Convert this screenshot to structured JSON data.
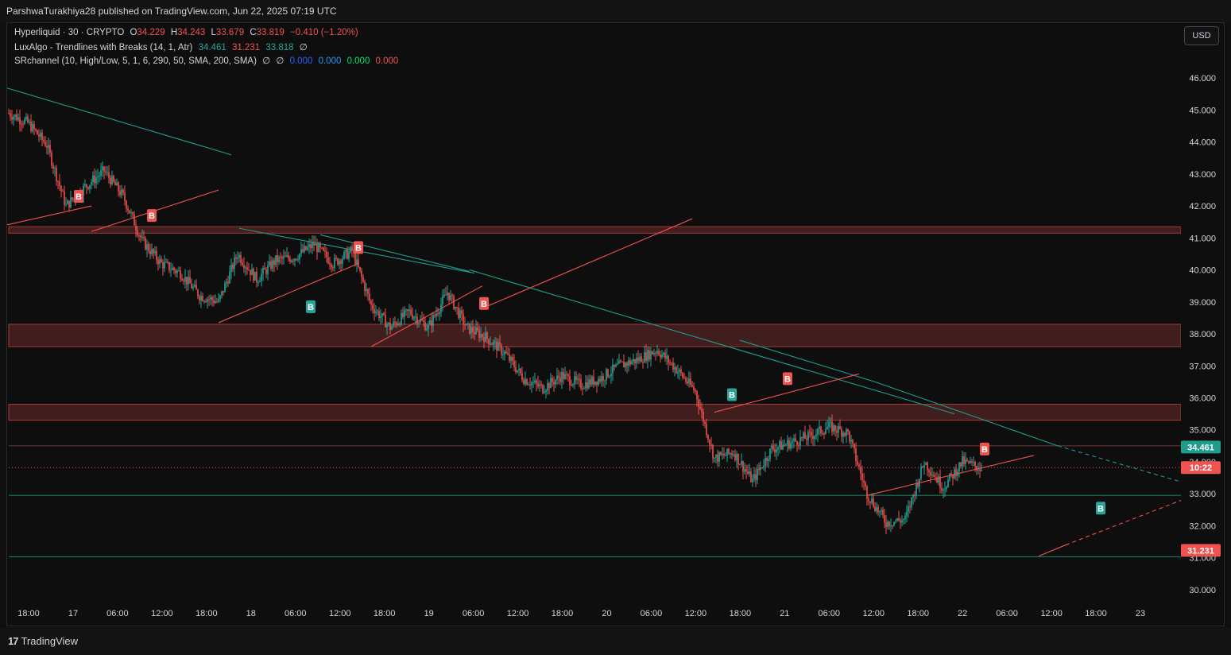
{
  "header": {
    "published": "ParshwaTurakhiya28 published on TradingView.com, Jun 22, 2025 07:19 UTC"
  },
  "legend": {
    "line1": {
      "symbol": "Hyperliquid · 30 · CRYPTO",
      "o_label": "O",
      "o": "34.229",
      "h_label": "H",
      "h": "34.243",
      "l_label": "L",
      "l": "33.679",
      "c_label": "C",
      "c": "33.819",
      "change": "−0.410 (−1.20%)"
    },
    "line2": {
      "name": "LuxAlgo - Trendlines with Breaks (14, 1, Atr)",
      "v1": "34.461",
      "v2": "31.231",
      "v3": "33.818",
      "v4": "∅"
    },
    "line3": {
      "name": "SRchannel (10, High/Low, 5, 1, 6, 290, 50, SMA, 200, SMA)",
      "v1": "∅",
      "v2": "∅",
      "v3": "0.000",
      "v4": "0.000",
      "v5": "0.000",
      "v6": "0.000"
    }
  },
  "currency_button": "USD",
  "footer": {
    "logo_text": "TradingView",
    "logo_mark": "17"
  },
  "colors": {
    "up": "#26a69a",
    "down": "#ef5350",
    "background": "#0e0e0e",
    "zone": "#6b2b2b",
    "teal_line": "#1e9c8c",
    "red_line": "#f0514f",
    "support": "#1b7a5a"
  },
  "chart_data": {
    "type": "candlestick",
    "title": "Hyperliquid · 30 · CRYPTO",
    "ylim": [
      29.5,
      46.7
    ],
    "y_ticks": [
      "46.000",
      "45.000",
      "44.000",
      "43.000",
      "42.000",
      "41.000",
      "40.000",
      "39.000",
      "38.000",
      "37.000",
      "36.000",
      "35.000",
      "34.000",
      "33.000",
      "32.000",
      "31.000",
      "30.000"
    ],
    "x_ticks": [
      "18:00",
      "17",
      "06:00",
      "12:00",
      "18:00",
      "18",
      "06:00",
      "12:00",
      "18:00",
      "19",
      "06:00",
      "12:00",
      "18:00",
      "20",
      "06:00",
      "12:00",
      "18:00",
      "21",
      "06:00",
      "12:00",
      "18:00",
      "22",
      "06:00",
      "12:00",
      "18:00",
      "23"
    ],
    "grid": false,
    "price_path": [
      [
        0,
        44.9
      ],
      [
        12,
        44.6
      ],
      [
        24,
        43.9
      ],
      [
        36,
        42.0
      ],
      [
        48,
        42.6
      ],
      [
        60,
        43.1
      ],
      [
        72,
        42.3
      ],
      [
        84,
        40.9
      ],
      [
        96,
        40.2
      ],
      [
        108,
        39.9
      ],
      [
        120,
        39.2
      ],
      [
        132,
        39.0
      ],
      [
        144,
        40.5
      ],
      [
        156,
        39.7
      ],
      [
        168,
        40.3
      ],
      [
        180,
        40.4
      ],
      [
        192,
        40.8
      ],
      [
        204,
        40.2
      ],
      [
        216,
        40.6
      ],
      [
        228,
        38.9
      ],
      [
        240,
        38.2
      ],
      [
        252,
        38.7
      ],
      [
        264,
        38.2
      ],
      [
        276,
        39.3
      ],
      [
        288,
        38.2
      ],
      [
        300,
        37.9
      ],
      [
        312,
        37.4
      ],
      [
        324,
        36.6
      ],
      [
        336,
        36.3
      ],
      [
        348,
        36.7
      ],
      [
        360,
        36.4
      ],
      [
        372,
        36.6
      ],
      [
        384,
        37.0
      ],
      [
        396,
        37.2
      ],
      [
        408,
        37.5
      ],
      [
        420,
        36.9
      ],
      [
        432,
        36.2
      ],
      [
        444,
        34.1
      ],
      [
        456,
        34.3
      ],
      [
        468,
        33.4
      ],
      [
        480,
        34.4
      ],
      [
        492,
        34.6
      ],
      [
        504,
        34.8
      ],
      [
        516,
        35.1
      ],
      [
        528,
        34.9
      ],
      [
        540,
        33.0
      ],
      [
        552,
        32.1
      ],
      [
        564,
        32.2
      ],
      [
        576,
        34.0
      ],
      [
        588,
        33.2
      ],
      [
        600,
        34.0
      ],
      [
        612,
        33.8
      ]
    ],
    "series": [
      {
        "name": "SR zones",
        "values": [
          [
            41.35,
            41.15
          ],
          [
            38.3,
            37.6
          ],
          [
            35.8,
            35.3
          ]
        ]
      },
      {
        "name": "Support levels",
        "values": [
          34.5,
          32.95,
          31.03
        ]
      },
      {
        "name": "Teal trendlines",
        "values": [
          [
            [
              -2,
              45.7
            ],
            [
              140,
              43.6
            ]
          ],
          [
            [
              145,
              41.3
            ],
            [
              293,
              39.9
            ]
          ],
          [
            [
              196,
              41.1
            ],
            [
              290,
              39.95
            ]
          ],
          [
            [
              290,
              40.0
            ],
            [
              595,
              35.5
            ]
          ],
          [
            [
              460,
              37.8
            ],
            [
              545,
              36.5
            ]
          ],
          [
            [
              545,
              36.5
            ],
            [
              660,
              34.5
            ]
          ],
          [
            [
              660,
              34.5
            ],
            [
              808,
              32.35
            ]
          ]
        ]
      },
      {
        "name": "Red trendlines",
        "values": [
          [
            [
              -2,
              41.4
            ],
            [
              52,
              42.0
            ]
          ],
          [
            [
              52,
              41.2
            ],
            [
              132,
              42.5
            ]
          ],
          [
            [
              132,
              38.35
            ],
            [
              220,
              40.2
            ]
          ],
          [
            [
              228,
              37.6
            ],
            [
              298,
              39.5
            ]
          ],
          [
            [
              298,
              38.8
            ],
            [
              430,
              41.6
            ]
          ],
          [
            [
              444,
              35.55
            ],
            [
              535,
              36.75
            ]
          ],
          [
            [
              540,
              32.95
            ],
            [
              645,
              34.2
            ]
          ],
          [
            [
              648,
              31.05
            ],
            [
              665,
              31.4
            ]
          ],
          [
            [
              665,
              31.4
            ],
            [
              808,
              34.15
            ]
          ]
        ]
      },
      {
        "name": "Break labels",
        "values": [
          [
            44,
            42.3,
            "B",
            "down"
          ],
          [
            90,
            41.7,
            "B",
            "down"
          ],
          [
            220,
            40.7,
            "B",
            "down"
          ],
          [
            190,
            38.85,
            "B",
            "up"
          ],
          [
            299,
            38.95,
            "B",
            "down"
          ],
          [
            455,
            36.1,
            "B",
            "up"
          ],
          [
            490,
            36.6,
            "B",
            "down"
          ],
          [
            614,
            34.4,
            "B",
            "down"
          ],
          [
            687,
            32.55,
            "B",
            "up"
          ]
        ]
      }
    ],
    "price_labels": [
      {
        "value": "34.461",
        "y": 34.461,
        "color": "#1e9c8c"
      },
      {
        "value": "10:22",
        "y": 33.819,
        "color": "#ef5350"
      },
      {
        "value": "31.231",
        "y": 31.231,
        "color": "#ef5350"
      }
    ],
    "current_price": 33.819
  }
}
